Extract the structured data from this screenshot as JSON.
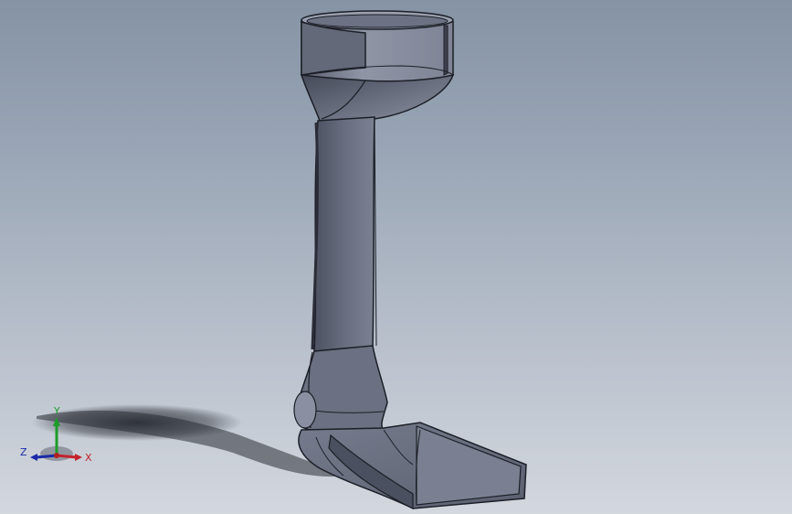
{
  "viewport": {
    "background_top": "#8593a5",
    "background_bottom": "#d3d7de",
    "model_fill": "#5f6576",
    "model_highlight": "#8e95a6",
    "model_edge": "#1c1f27"
  },
  "triad": {
    "x_label": "X",
    "y_label": "Y",
    "z_label": "Z",
    "x_color": "#c4222c",
    "y_color": "#1c9c2a",
    "z_color": "#1b2aa8"
  }
}
